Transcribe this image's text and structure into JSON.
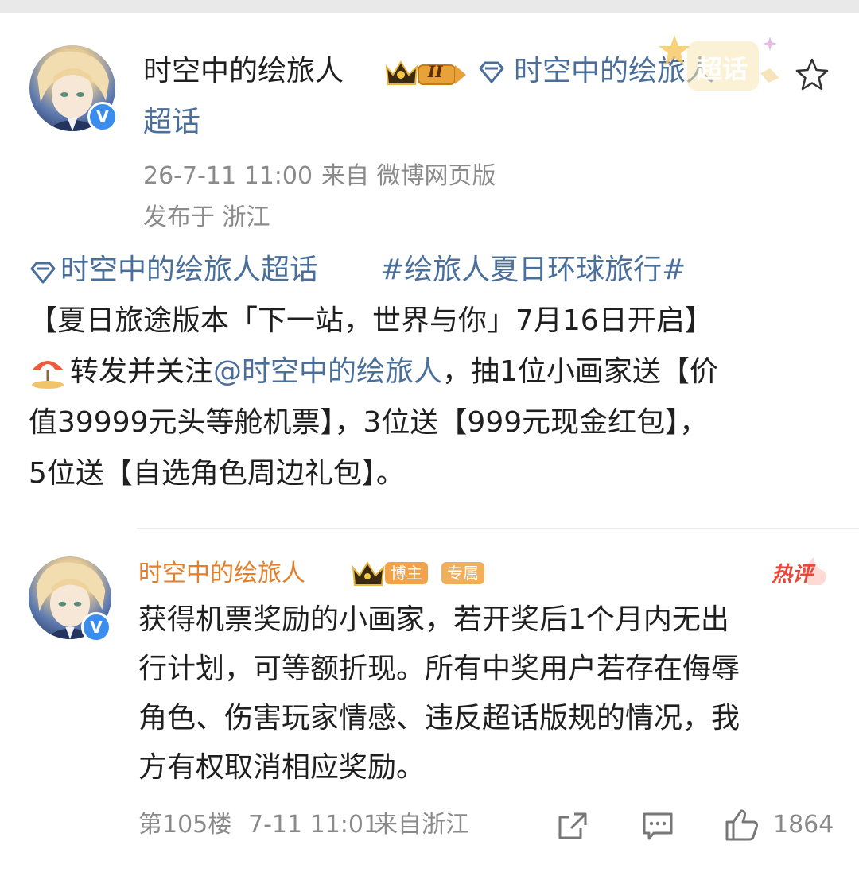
{
  "post": {
    "author": "时空中的绘旅人",
    "level_badge": "II",
    "topic_line1": "时空中的绘旅人",
    "topic_line2": "超话",
    "sticker_text": "超话",
    "time": "26-7-11 11:00",
    "source": "来自 微博网页版",
    "location": "发布于 浙江",
    "topic_tag": "时空中的绘旅人超话",
    "hashtag": "#绘旅人夏日环球旅行#",
    "body_line1": "【夏日旅途版本「下一站，世界与你」7月16日开启】",
    "body_line2_prefix": "转发并关注",
    "body_mention": "@时空中的绘旅人",
    "body_line2_suffix": "，抽1位小画家送【价",
    "body_line3": "值39999元头等舱机票】，3位送【999元现金红包】，",
    "body_line4": "5位送【自选角色周边礼包】。"
  },
  "reply": {
    "author": "时空中的绘旅人",
    "badge_blogger": "博主",
    "badge_exclusive": "专属",
    "hot_label": "热评",
    "text_lines": [
      "获得机票奖励的小画家，若开奖后1个月内无出",
      "行计划，可等额折现。所有中奖用户若存在侮辱",
      "角色、伤害玩家情感、违反超话版规的情况，我",
      "方有权取消相应奖励。"
    ],
    "floor": "第105楼",
    "time": "7-11 11:01",
    "source": "来自浙江",
    "like_count": "1864"
  },
  "icons": {
    "star": "star-outline-icon",
    "diamond": "supertopic-diamond-icon",
    "crown": "crown-icon",
    "verified": "verified-v-icon",
    "beach": "beach-umbrella-icon",
    "share": "share-icon",
    "comment": "comment-icon",
    "like": "thumbs-up-icon"
  },
  "colors": {
    "link_blue": "#4a6f9b",
    "meta_gray": "#8a8a8a",
    "name_orange": "#e27f2a",
    "verified_blue": "#3b8ded"
  }
}
